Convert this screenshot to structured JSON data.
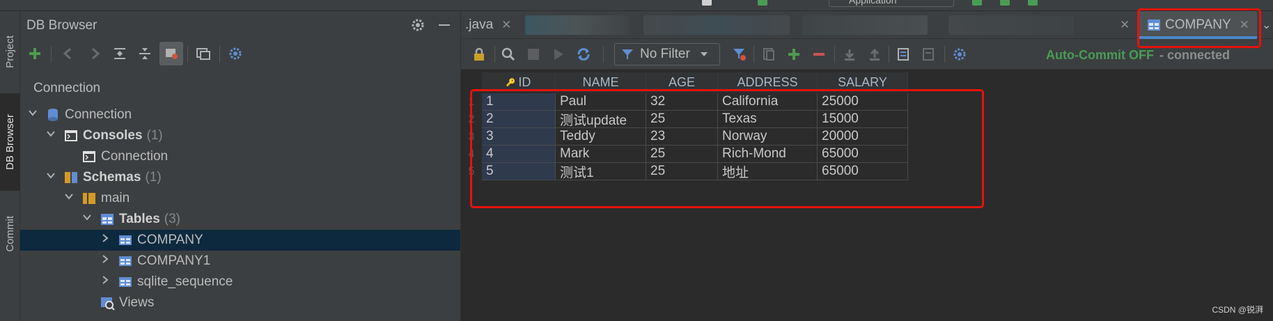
{
  "top": {
    "run_config": "Application"
  },
  "stripe": {
    "project": "Project",
    "db_browser": "DB Browser",
    "commit": "Commit"
  },
  "panel": {
    "title": "DB Browser",
    "connection_label": "Connection",
    "tree": [
      {
        "label": "Connection",
        "count": "",
        "bold": false,
        "icon": "database-icon",
        "expand": "down",
        "indent": 0
      },
      {
        "label": "Consoles",
        "count": "(1)",
        "bold": true,
        "icon": "consoles-icon",
        "expand": "down",
        "indent": 1
      },
      {
        "label": "Connection",
        "count": "",
        "bold": false,
        "icon": "console-icon",
        "expand": "none",
        "indent": 2
      },
      {
        "label": "Schemas",
        "count": "(1)",
        "bold": true,
        "icon": "schemas-icon",
        "expand": "down",
        "indent": 1
      },
      {
        "label": "main",
        "count": "",
        "bold": false,
        "icon": "schema-icon",
        "expand": "down",
        "indent": 2
      },
      {
        "label": "Tables",
        "count": "(3)",
        "bold": true,
        "icon": "tables-icon",
        "expand": "down",
        "indent": 3
      },
      {
        "label": "COMPANY",
        "count": "",
        "bold": false,
        "icon": "table-icon",
        "expand": "right",
        "indent": 4,
        "selected": true
      },
      {
        "label": "COMPANY1",
        "count": "",
        "bold": false,
        "icon": "table-icon",
        "expand": "right",
        "indent": 4
      },
      {
        "label": "sqlite_sequence",
        "count": "",
        "bold": false,
        "icon": "table-icon",
        "expand": "right",
        "indent": 4
      },
      {
        "label": "Views",
        "count": "",
        "bold": false,
        "icon": "views-icon",
        "expand": "none",
        "indent": 3
      }
    ]
  },
  "tabs": {
    "java_tab": ".java",
    "active_tab": "COMPANY"
  },
  "toolbar": {
    "filter": "No Filter",
    "autocommit": "Auto-Commit OFF",
    "connection_status": "- connected"
  },
  "grid": {
    "columns": [
      "ID",
      "NAME",
      "AGE",
      "ADDRESS",
      "SALARY"
    ],
    "rows": [
      {
        "num": "1",
        "cells": [
          "1",
          "Paul",
          "32",
          "California",
          "25000"
        ]
      },
      {
        "num": "2",
        "cells": [
          "2",
          "测试update",
          "25",
          "Texas",
          "15000"
        ]
      },
      {
        "num": "3",
        "cells": [
          "3",
          "Teddy",
          "23",
          "Norway",
          "20000"
        ]
      },
      {
        "num": "4",
        "cells": [
          "4",
          "Mark",
          "25",
          "Rich-Mond",
          "65000"
        ]
      },
      {
        "num": "5",
        "cells": [
          "5",
          "测试1",
          "25",
          "地址",
          "65000"
        ]
      }
    ]
  },
  "watermark": "CSDN @锐湃",
  "colors": {
    "accent": "#4a88c7",
    "highlight": "#e8120c",
    "autocommit": "#499c54",
    "selected_row": "#0d293e"
  }
}
